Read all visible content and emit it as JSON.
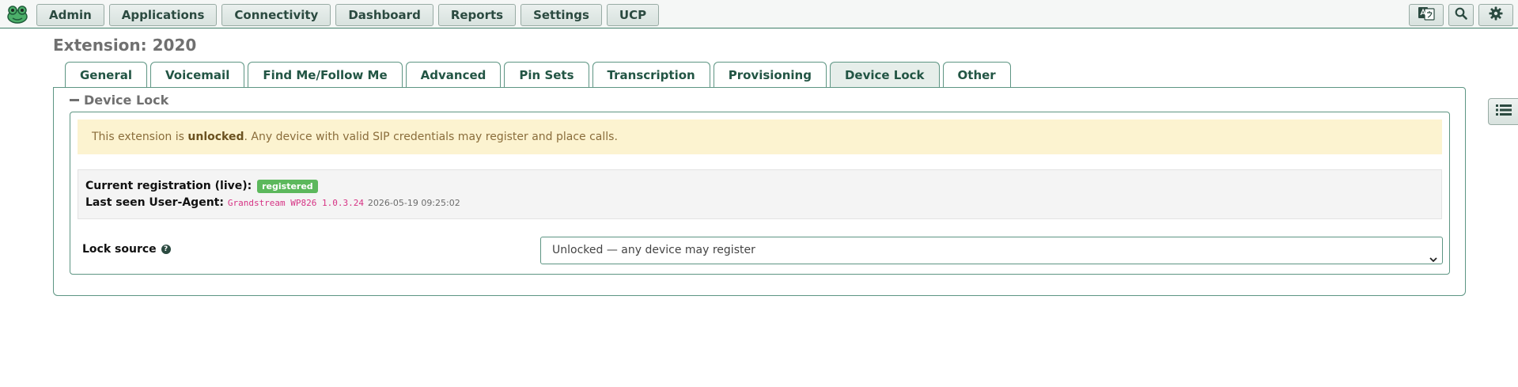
{
  "nav": {
    "items": [
      {
        "label": "Admin"
      },
      {
        "label": "Applications"
      },
      {
        "label": "Connectivity"
      },
      {
        "label": "Dashboard"
      },
      {
        "label": "Reports"
      },
      {
        "label": "Settings"
      },
      {
        "label": "UCP"
      }
    ],
    "right_icons": [
      "language-icon",
      "search-icon",
      "gear-icon"
    ]
  },
  "page": {
    "title": "Extension: 2020"
  },
  "tabs": [
    {
      "label": "General"
    },
    {
      "label": "Voicemail"
    },
    {
      "label": "Find Me/Follow Me"
    },
    {
      "label": "Advanced"
    },
    {
      "label": "Pin Sets"
    },
    {
      "label": "Transcription"
    },
    {
      "label": "Provisioning"
    },
    {
      "label": "Device Lock",
      "active": true
    },
    {
      "label": "Other"
    }
  ],
  "section": {
    "title": "Device Lock"
  },
  "alert": {
    "prefix": "This extension is ",
    "emphasis": "unlocked",
    "suffix": ". Any device with valid SIP credentials may register and place calls."
  },
  "registration": {
    "current_label": "Current registration (live):",
    "status": "registered",
    "last_seen_label": "Last seen User-Agent:",
    "user_agent": "Grandstream WP826 1.0.3.24",
    "timestamp": "2026-05-19 09:25:02"
  },
  "lock_source": {
    "label": "Lock source",
    "selected": "Unlocked — any device may register"
  },
  "colors": {
    "accent": "#3f7f69",
    "badge": "#5cb85c",
    "alert_bg": "#fcf3d0",
    "ua_text": "#d63384"
  }
}
